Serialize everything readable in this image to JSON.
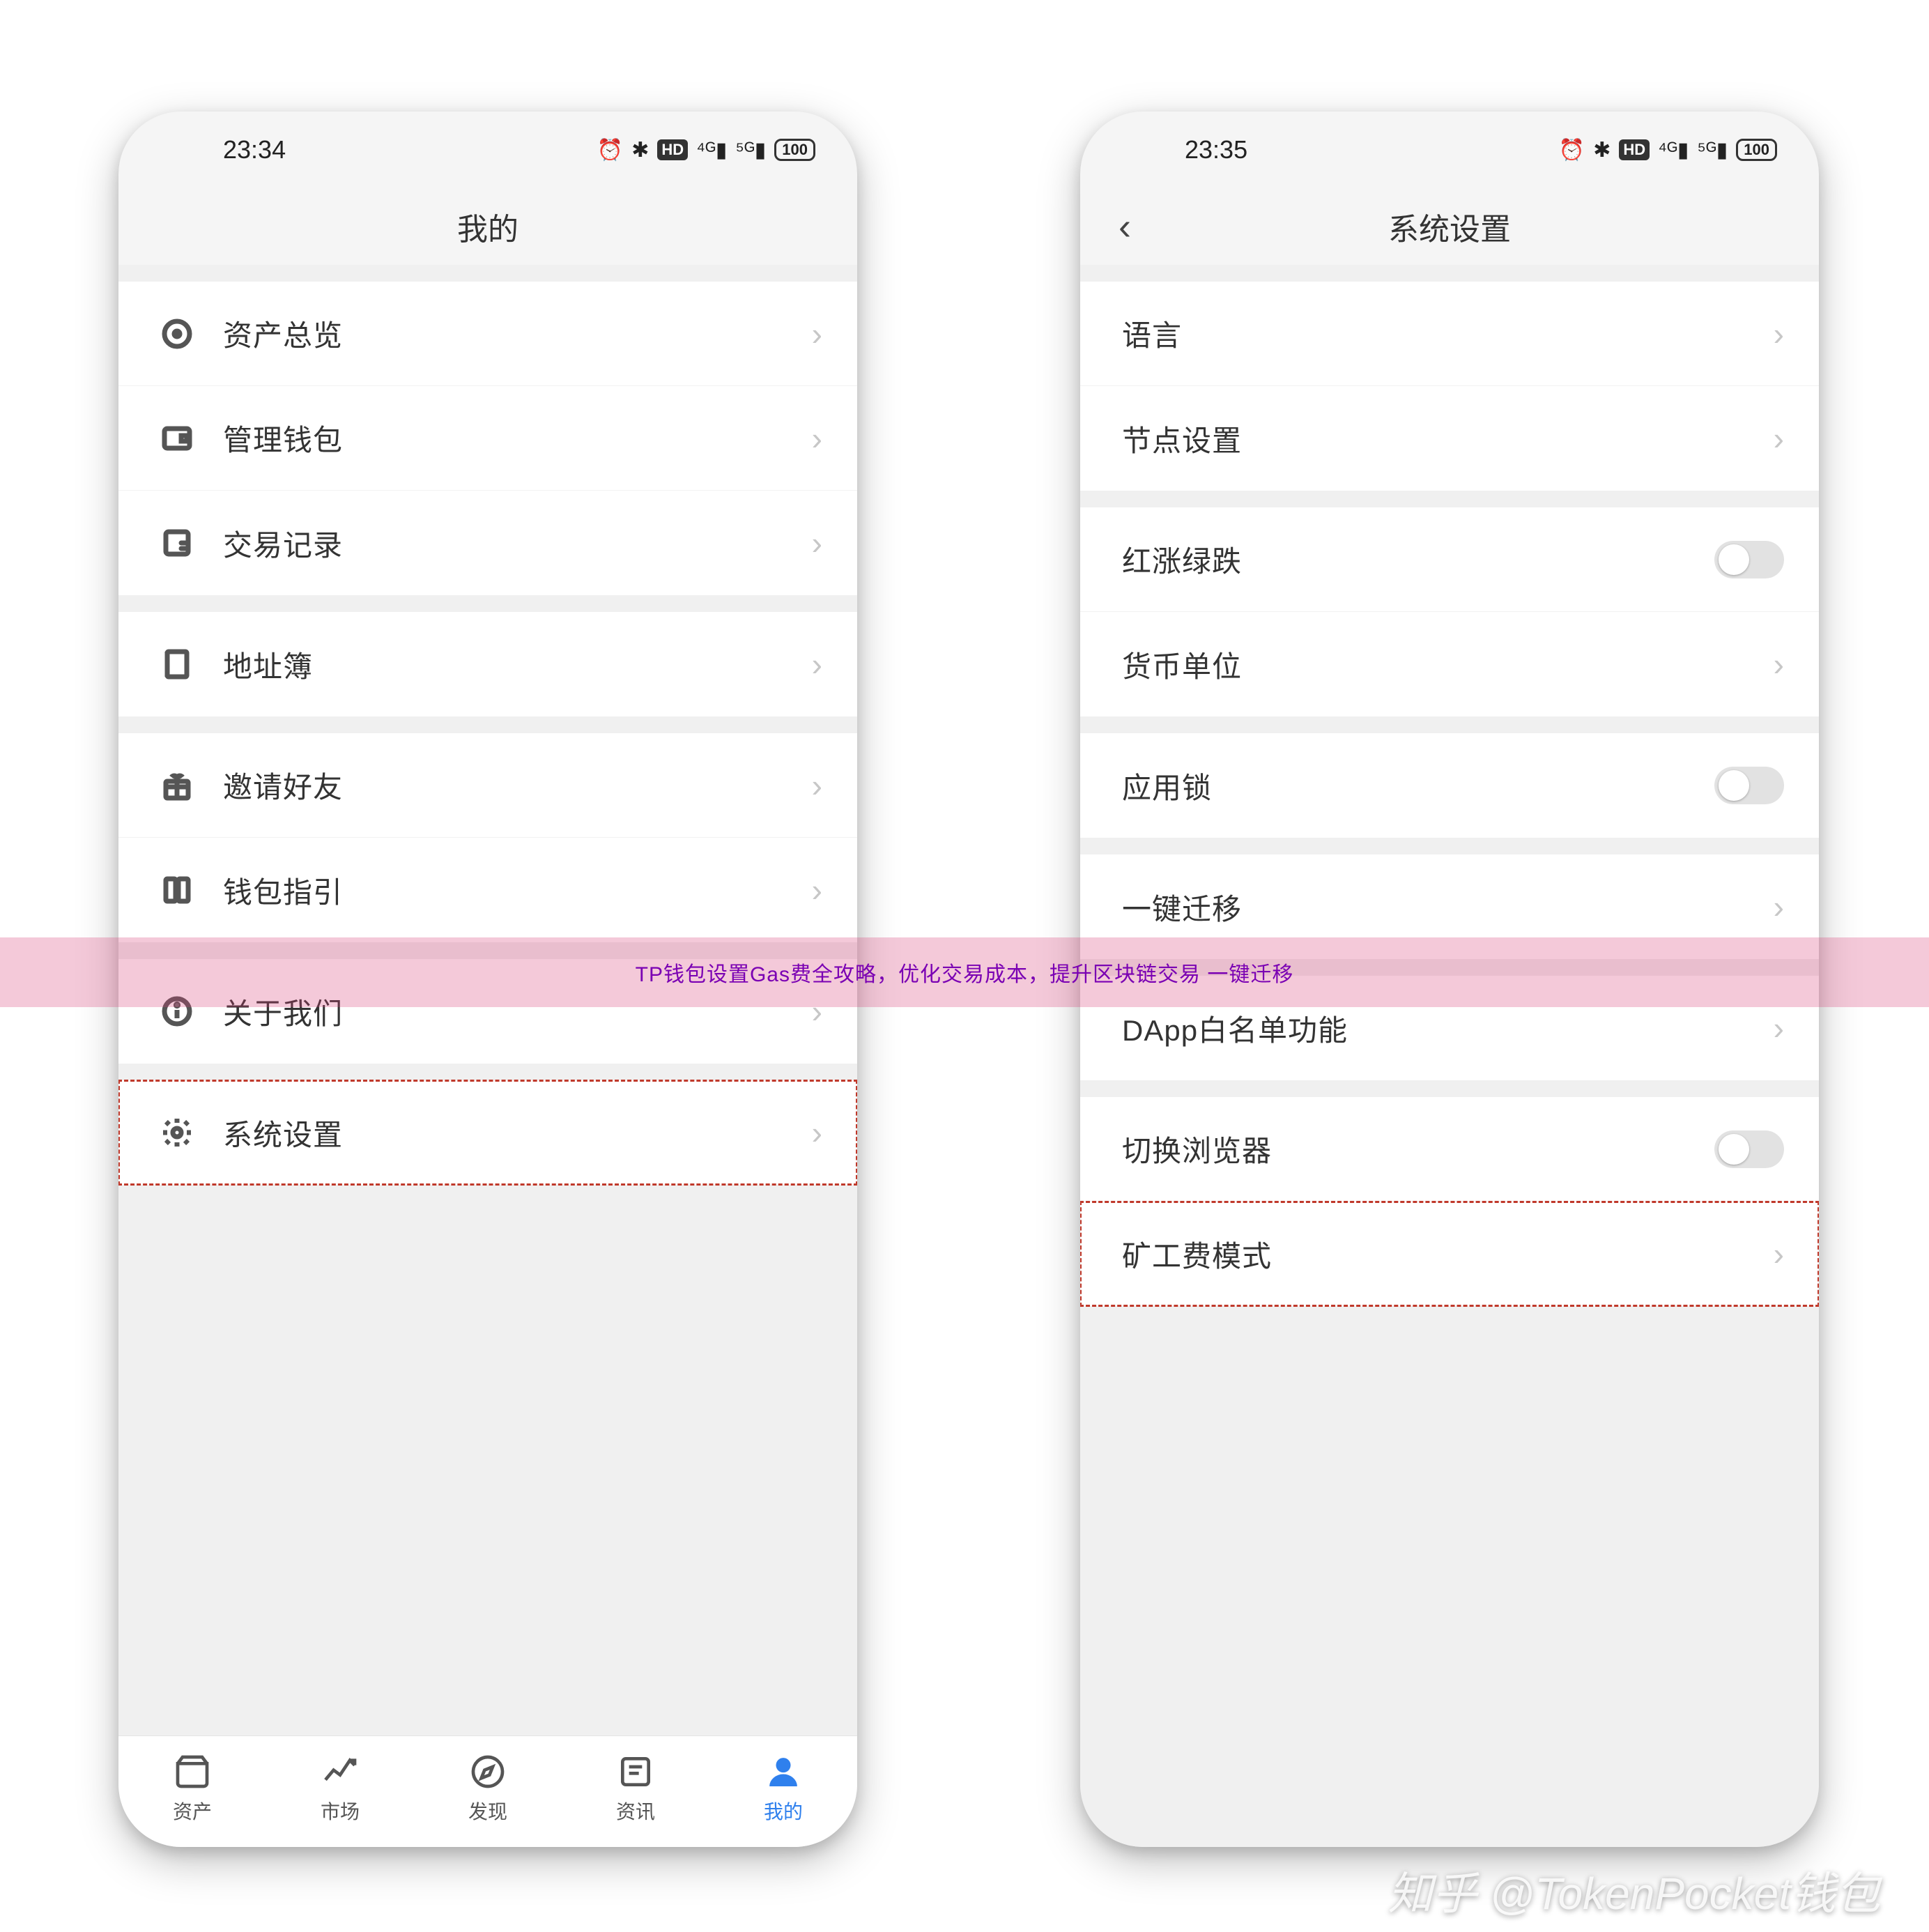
{
  "status_bar": {
    "left_time_a": "23:34",
    "left_time_b": "23:35",
    "icons_right": "⏰ ✱ HD ⁴ᴳ ⁵ᴳ 🔋"
  },
  "left_screen": {
    "title": "我的",
    "groups": [
      [
        {
          "key": "assets-overview",
          "icon": "target-icon",
          "label": "资产总览"
        },
        {
          "key": "manage-wallets",
          "icon": "wallet-icon",
          "label": "管理钱包"
        },
        {
          "key": "transactions",
          "icon": "history-icon",
          "label": "交易记录"
        }
      ],
      [
        {
          "key": "address-book",
          "icon": "book-icon",
          "label": "地址簿"
        }
      ],
      [
        {
          "key": "invite-friends",
          "icon": "gift-icon",
          "label": "邀请好友"
        },
        {
          "key": "wallet-guide",
          "icon": "guide-icon",
          "label": "钱包指引"
        }
      ],
      [
        {
          "key": "about-us",
          "icon": "info-icon",
          "label": "关于我们"
        }
      ],
      [
        {
          "key": "system-settings",
          "icon": "gear-icon",
          "label": "系统设置",
          "highlight": true
        }
      ]
    ],
    "tabs": [
      {
        "key": "tab-assets",
        "icon": "wallet-tab-icon",
        "label": "资产"
      },
      {
        "key": "tab-market",
        "icon": "chart-tab-icon",
        "label": "市场"
      },
      {
        "key": "tab-discover",
        "icon": "compass-tab-icon",
        "label": "发现"
      },
      {
        "key": "tab-news",
        "icon": "news-tab-icon",
        "label": "资讯"
      },
      {
        "key": "tab-mine",
        "icon": "person-tab-icon",
        "label": "我的",
        "active": true
      }
    ]
  },
  "right_screen": {
    "title": "系统设置",
    "groups": [
      [
        {
          "key": "language",
          "label": "语言",
          "type": "nav"
        },
        {
          "key": "node-settings",
          "label": "节点设置",
          "type": "nav"
        }
      ],
      [
        {
          "key": "price-color",
          "label": "红涨绿跌",
          "type": "toggle"
        },
        {
          "key": "currency-unit",
          "label": "货币单位",
          "type": "nav"
        }
      ],
      [
        {
          "key": "app-lock",
          "label": "应用锁",
          "type": "toggle"
        }
      ],
      [
        {
          "key": "one-click-migrate",
          "label": "一键迁移",
          "type": "nav"
        }
      ],
      [
        {
          "key": "dapp-whitelist",
          "label": "DApp白名单功能",
          "type": "nav"
        }
      ],
      [
        {
          "key": "switch-browser",
          "label": "切换浏览器",
          "type": "toggle"
        },
        {
          "key": "miner-fee-mode",
          "label": "矿工费模式",
          "type": "nav",
          "highlight": true
        }
      ]
    ]
  },
  "overlay_text": "TP钱包设置Gas费全攻略，优化交易成本，提升区块链交易   一键迁移",
  "watermark": "知乎 @TokenPocket钱包"
}
